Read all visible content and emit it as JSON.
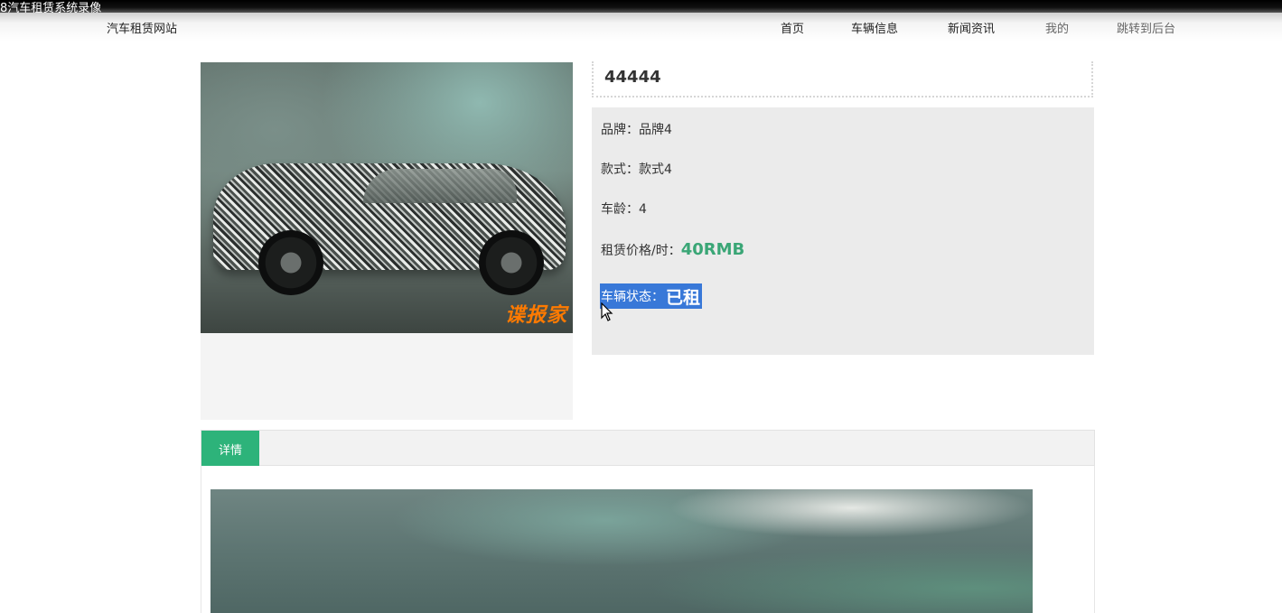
{
  "recording": {
    "title": "8汽车租赁系统录像"
  },
  "nav": {
    "site_name": "汽车租赁网站",
    "links": [
      "首页",
      "车辆信息",
      "新闻资讯",
      "我的",
      "跳转到后台"
    ]
  },
  "car": {
    "name": "44444",
    "photo_watermark": "谍报家",
    "brand_label": "品牌：",
    "brand": "品牌4",
    "style_label": "款式：",
    "style": "款式4",
    "age_label": "车龄：",
    "age": "4",
    "price_label": "租赁价格/时：",
    "price": "40RMB",
    "status_label": "车辆状态：",
    "status": "已租"
  },
  "tabs": [
    {
      "label": "详情",
      "active": true
    }
  ],
  "colors": {
    "accent": "#2db37a",
    "price": "#3aa676",
    "selection": "#3878d8",
    "info_bg": "#ebebeb"
  },
  "icons": {
    "cursor": "arrow-cursor-icon",
    "car_photo": "car-photo"
  }
}
